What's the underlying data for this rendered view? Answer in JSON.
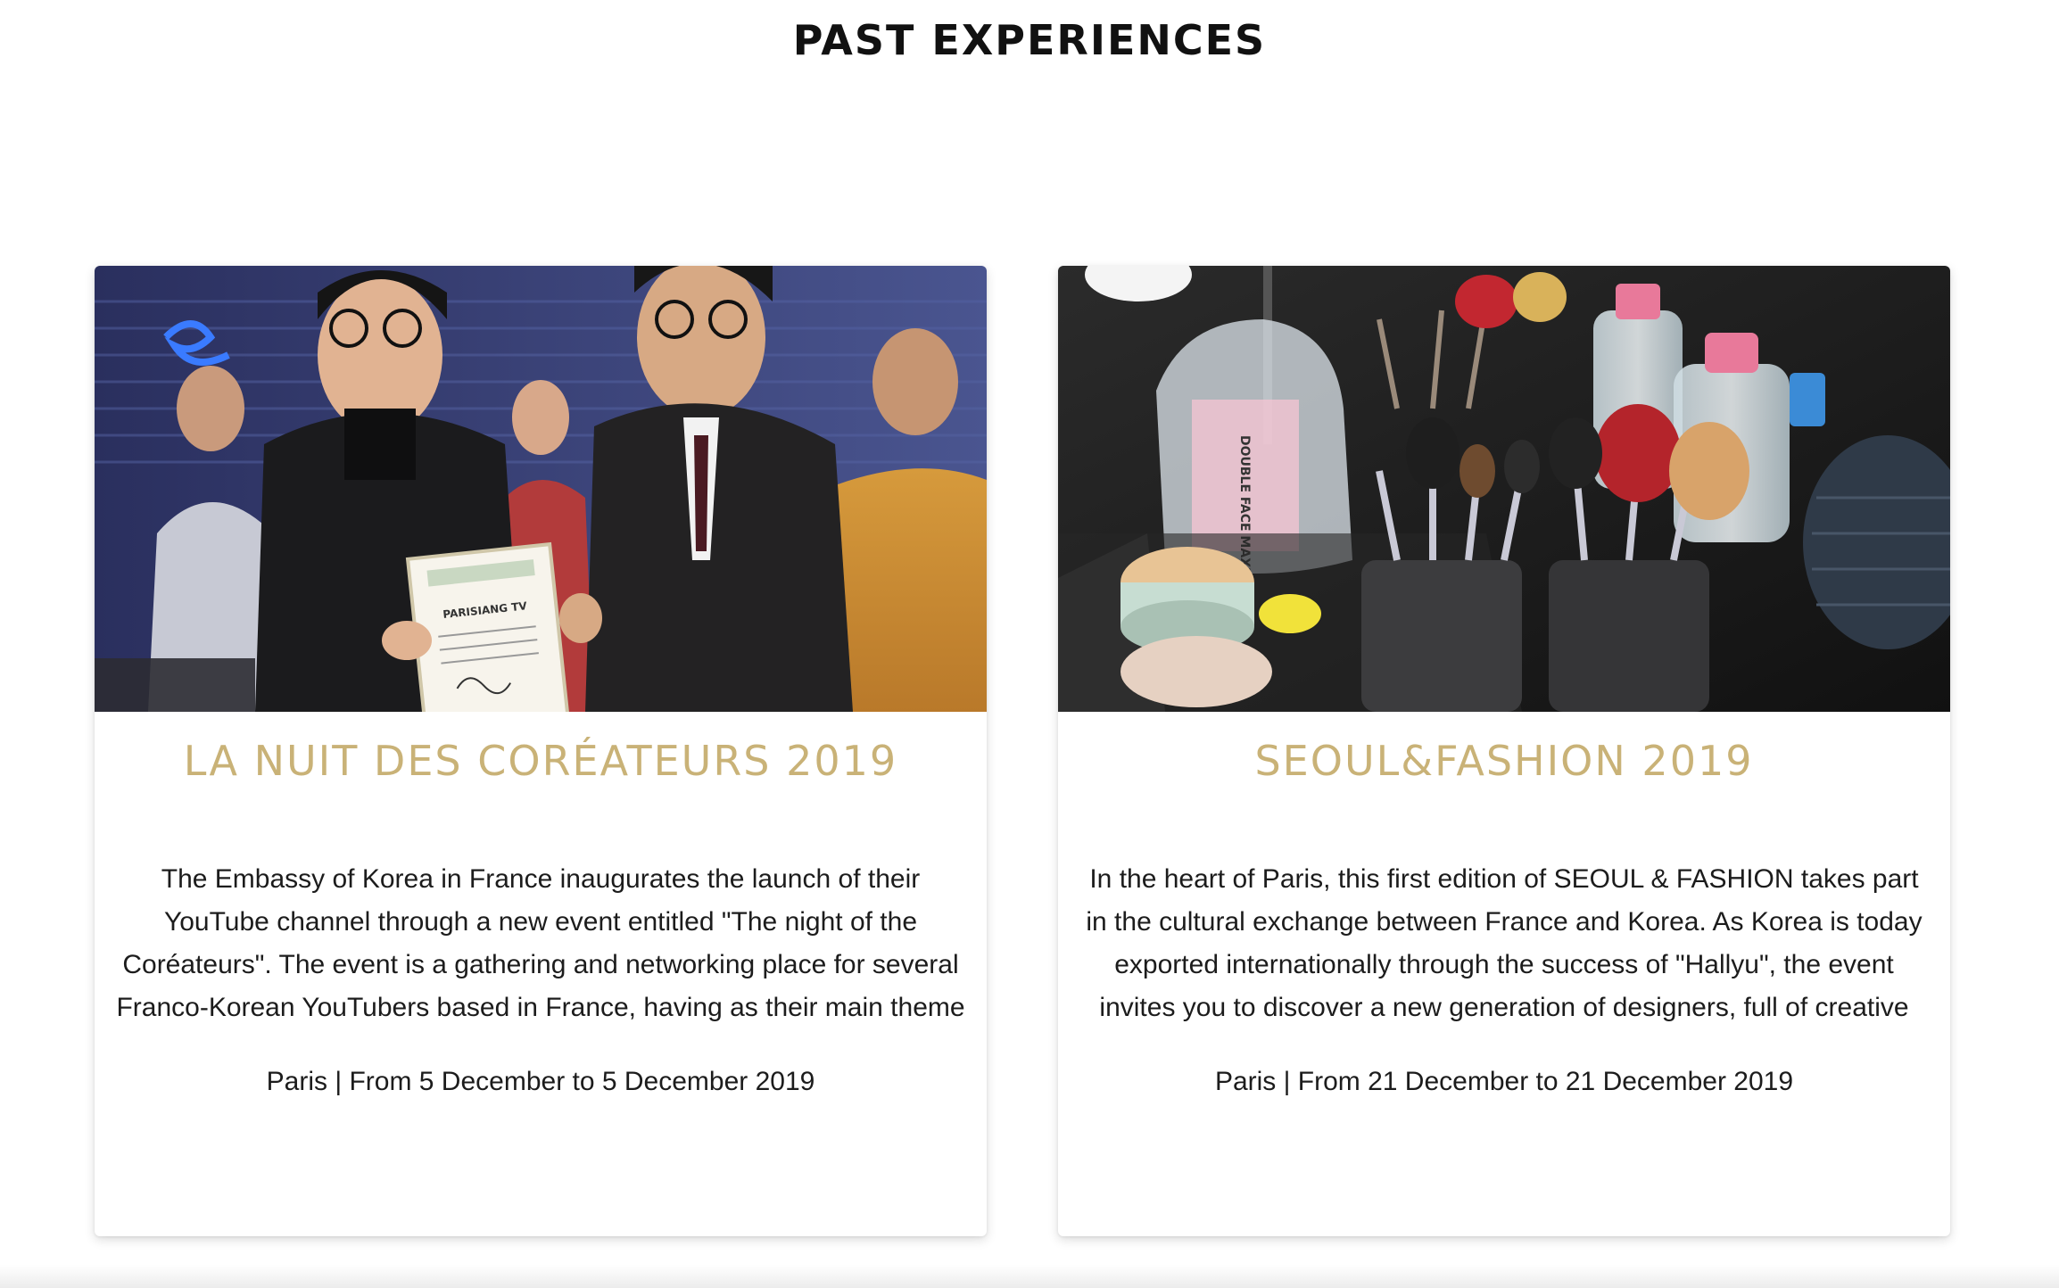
{
  "section": {
    "title": "PAST EXPERIENCES"
  },
  "colors": {
    "title": "#111111",
    "card_title": "#c9b277",
    "body_text": "#1c1c1c"
  },
  "events": [
    {
      "title": "LA NUIT DES CORÉATEURS 2019",
      "image_alt": "Award ceremony photo with a certificate reading PARISIANG TV",
      "certificate_text": "PARISIANG TV",
      "description": "The Embassy of Korea in France inaugurates the launch of their YouTube channel through a new event entitled \"The night of the Coréateurs\". The event is a gathering and networking place for several Franco-Korean YouTubers based in France, having as their main theme the Korean culture (cosmetics, music, food,",
      "meta": "Paris | From 5 December to 5 December 2019"
    },
    {
      "title": "SEOUL&FASHION 2019",
      "image_alt": "Makeup brushes and cosmetics on a backstage table",
      "package_text": "DOUBLE FACE MAXI OVALES",
      "description": "In the heart of Paris, this first edition of SEOUL & FASHION takes part in the cultural exchange between France and Korea. As Korea is today exported internationally through the success of \"Hallyu\", the event invites you to discover a new generation of designers, full of creative talents. Between futuristic style",
      "meta": "Paris | From 21 December to 21 December 2019"
    }
  ]
}
